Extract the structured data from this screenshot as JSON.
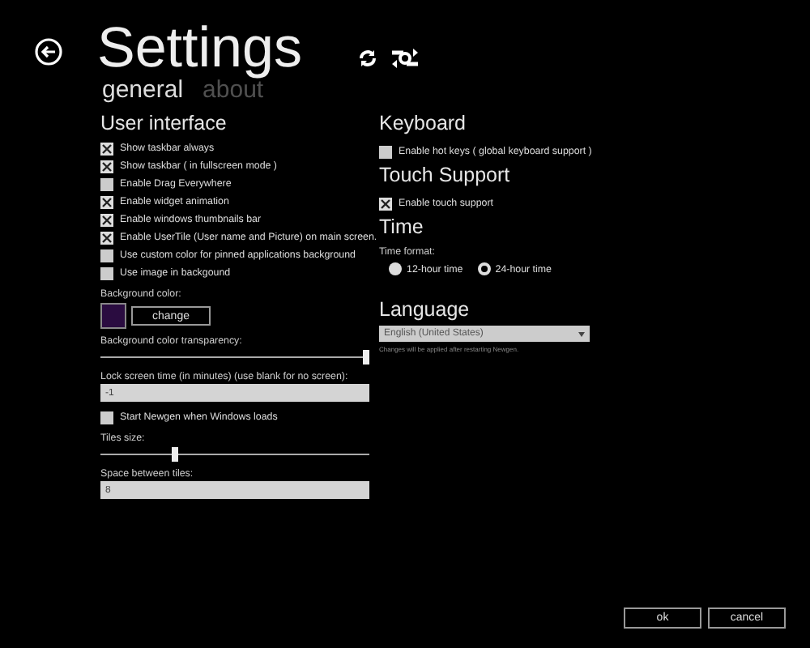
{
  "header": {
    "title": "Settings",
    "tabs": [
      {
        "label": "general",
        "selected": true
      },
      {
        "label": "about",
        "selected": false
      }
    ]
  },
  "user_interface": {
    "heading": "User interface",
    "options": [
      {
        "label": "Show taskbar always",
        "checked": true
      },
      {
        "label": "Show taskbar ( in fullscreen mode )",
        "checked": true
      },
      {
        "label": "Enable Drag Everywhere",
        "checked": false
      },
      {
        "label": "Enable widget animation",
        "checked": true
      },
      {
        "label": "Enable windows thumbnails bar",
        "checked": true
      },
      {
        "label": "Enable UserTile (User name and Picture) on main screen.",
        "checked": true
      },
      {
        "label": "Use custom color for pinned applications background",
        "checked": false
      },
      {
        "label": "Use image in backgound",
        "checked": false
      }
    ],
    "background_color": {
      "label": "Background color:",
      "color": "#2a0c40",
      "button": "change"
    },
    "transparency": {
      "label": "Background color transparency:",
      "level": 0.99
    },
    "lock_screen": {
      "label": "Lock screen time (in minutes) (use blank for no screen):",
      "value": "-1"
    },
    "start_option": {
      "label": "Start Newgen when Windows loads",
      "checked": false
    },
    "tiles_size": {
      "label": "Tiles size:",
      "level": 0.28
    },
    "tile_spacing": {
      "label": "Space between tiles:",
      "value": "8"
    }
  },
  "keyboard": {
    "heading": "Keyboard",
    "options": [
      {
        "label": "Enable hot keys ( global keyboard support )",
        "checked": false
      }
    ]
  },
  "touch": {
    "heading": "Touch Support",
    "options": [
      {
        "label": "Enable touch support",
        "checked": true
      }
    ]
  },
  "time": {
    "heading": "Time",
    "label": "Time format:",
    "formats": [
      {
        "label": "12-hour time",
        "selected": false
      },
      {
        "label": "24-hour time",
        "selected": true
      }
    ]
  },
  "language": {
    "heading": "Language",
    "value": "English (United States)",
    "note": "Changes will be applied after restarting Newgen."
  },
  "buttons": [
    "ok",
    "cancel"
  ]
}
